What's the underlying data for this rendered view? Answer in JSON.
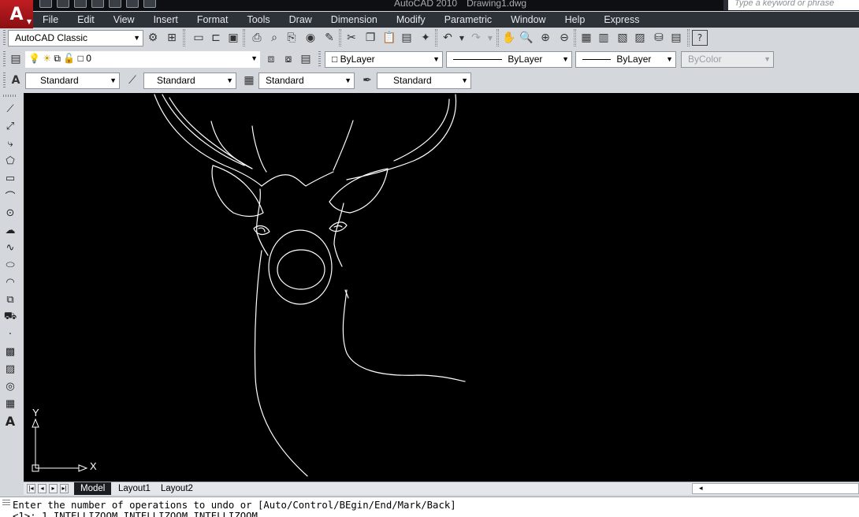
{
  "window": {
    "app_name": "AutoCAD 2010",
    "document": "Drawing1.dwg",
    "search_placeholder": "Type a keyword or phrase"
  },
  "app_logo": {
    "letter": "A",
    "menu_arrow": "▼"
  },
  "menu": [
    "File",
    "Edit",
    "View",
    "Insert",
    "Format",
    "Tools",
    "Draw",
    "Dimension",
    "Modify",
    "Parametric",
    "Window",
    "Help",
    "Express"
  ],
  "toolbar_workspace": {
    "workspace": "AutoCAD Classic"
  },
  "layer_toolbar": {
    "current_layer": "0"
  },
  "properties_toolbar": {
    "color": "ByLayer",
    "linetype": "ByLayer",
    "lineweight": "ByLayer",
    "plot_style": "ByColor"
  },
  "styles_toolbar": {
    "text_style": "Standard",
    "dim_style": "Standard",
    "table_style": "Standard",
    "multileader_style": "Standard"
  },
  "canvas": {
    "background": "#000000",
    "linework_color": "#ffffff"
  },
  "ucs_icon": {
    "x_label": "X",
    "y_label": "Y"
  },
  "layout_tabs": [
    "Model",
    "Layout1",
    "Layout2"
  ],
  "command_line": {
    "line1": "Enter the number of operations to undo or [Auto/Control/BEgin/End/Mark/Back]",
    "line2": "<1>: 1 INTELLIZOOM INTELLIZOOM INTELLIZOOM"
  },
  "colors": {
    "menubar": "#2d3138",
    "titlebar": "#0d0f12",
    "logo_red": "#c01d22",
    "toolbar_bg": "#d4d8dd"
  }
}
